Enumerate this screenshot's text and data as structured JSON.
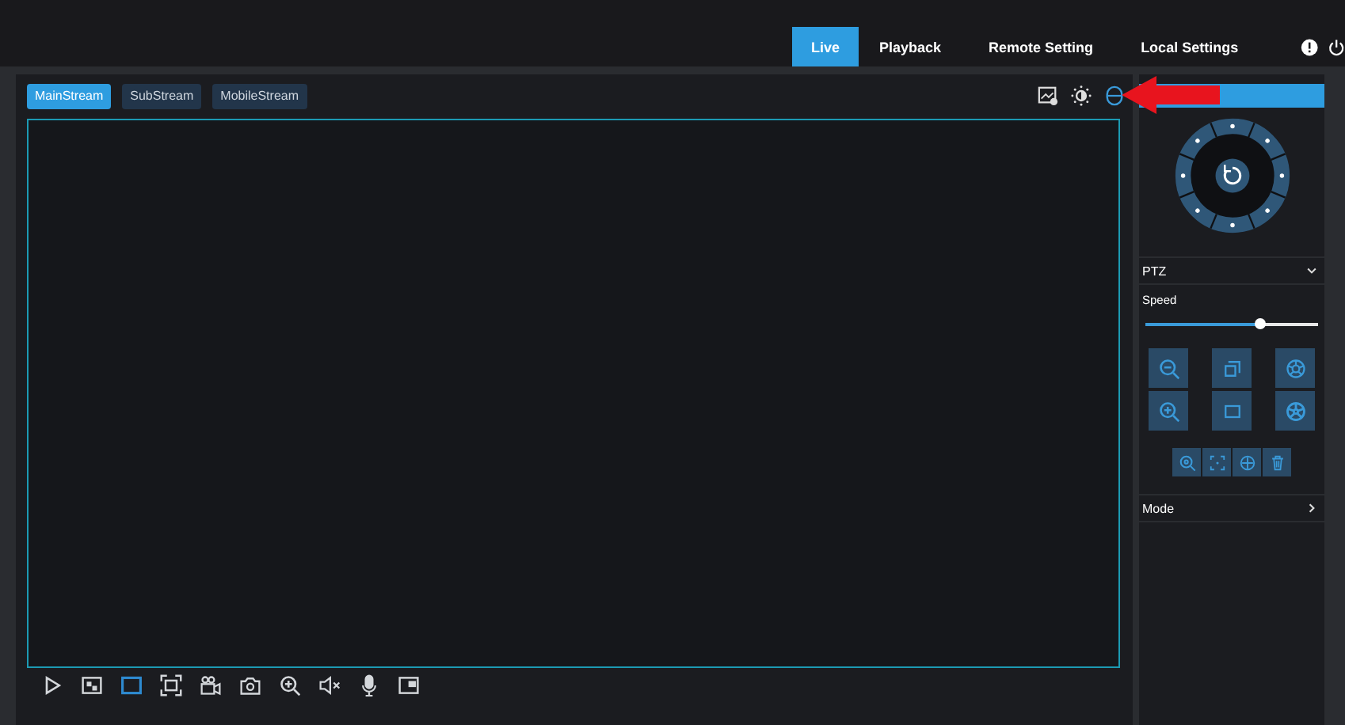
{
  "nav": {
    "tabs": [
      {
        "label": "Live",
        "selected": true
      },
      {
        "label": "Playback",
        "selected": false
      },
      {
        "label": "Remote Setting",
        "selected": false
      },
      {
        "label": "Local Settings",
        "selected": false
      }
    ]
  },
  "streams": [
    {
      "label": "MainStream",
      "selected": true
    },
    {
      "label": "SubStream",
      "selected": false
    },
    {
      "label": "MobileStream",
      "selected": false
    }
  ],
  "bottom_tools": [
    {
      "kind": "play",
      "selected": false
    },
    {
      "kind": "window",
      "selected": false
    },
    {
      "kind": "square",
      "selected": true
    },
    {
      "kind": "fullscreen",
      "selected": false
    },
    {
      "kind": "record",
      "selected": false
    },
    {
      "kind": "snapshot",
      "selected": false
    },
    {
      "kind": "zoom",
      "selected": false
    },
    {
      "kind": "mute",
      "selected": false
    },
    {
      "kind": "mic",
      "selected": false
    },
    {
      "kind": "pip",
      "selected": false
    }
  ],
  "ptz": {
    "title": "PTZ",
    "expanded": true,
    "speed_label": "Speed",
    "speed": {
      "level": 0.66
    }
  },
  "mode": {
    "label": "Mode"
  }
}
